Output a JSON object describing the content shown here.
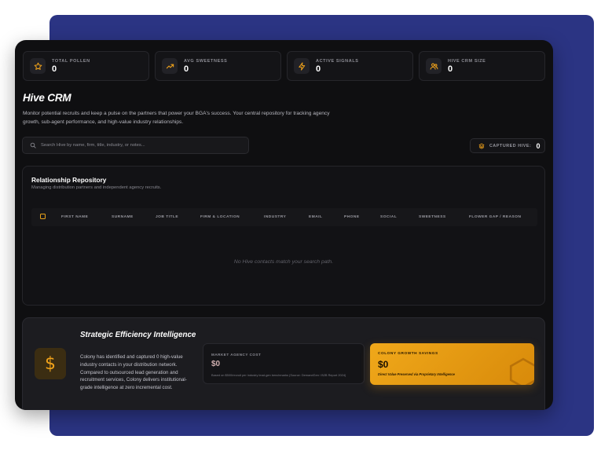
{
  "stats": [
    {
      "label": "TOTAL POLLEN",
      "value": "0",
      "icon": "star-icon"
    },
    {
      "label": "AVG SWEETNESS",
      "value": "0",
      "icon": "trending-up-icon"
    },
    {
      "label": "ACTIVE SIGNALS",
      "value": "0",
      "icon": "lightning-icon"
    },
    {
      "label": "HIVE CRM SIZE",
      "value": "0",
      "icon": "users-icon"
    }
  ],
  "header": {
    "title": "Hive CRM",
    "description": "Monitor potential recruits and keep a pulse on the partners that power your BGA's success. Your central repository for tracking agency growth, sub-agent performance, and high-value industry relationships."
  },
  "search": {
    "placeholder": "Search Hive by name, firm, title, industry, or notes..."
  },
  "captured": {
    "label": "CAPTURED HIVE:",
    "value": "0"
  },
  "repository": {
    "title": "Relationship Repository",
    "subtitle": "Managing distribution partners and independent agency recruits.",
    "columns": [
      "FIRST NAME",
      "SURNAME",
      "JOB TITLE",
      "FIRM & LOCATION",
      "INDUSTRY",
      "EMAIL",
      "PHONE",
      "SOCIAL",
      "SWEETNESS",
      "FLOWER GAP / REASON"
    ],
    "empty_message": "No Hive contacts match your search path."
  },
  "strategy": {
    "title": "Strategic Efficiency Intelligence",
    "body": "Colony has identified and captured 0 high-value industry contacts in your distribution network. Compared to outsourced lead generation and recruitment services, Colony delivers institutional-grade intelligence at zero incremental cost.",
    "icon_symbol": "$",
    "cost": {
      "label": "MARKET AGENCY COST",
      "value": "$0",
      "note": "Based on $500/recruit per industry lead-gen benchmarks (Source: DemandGen / B2B Report 2024)"
    },
    "savings": {
      "label": "COLONY GROWTH SAVINGS",
      "value": "$0",
      "note": "Direct Value Preserved via Proprietary Intelligence"
    }
  },
  "colors": {
    "accent": "#f0a21a",
    "backdrop": "#2b3483",
    "panel": "#0f0f11"
  }
}
